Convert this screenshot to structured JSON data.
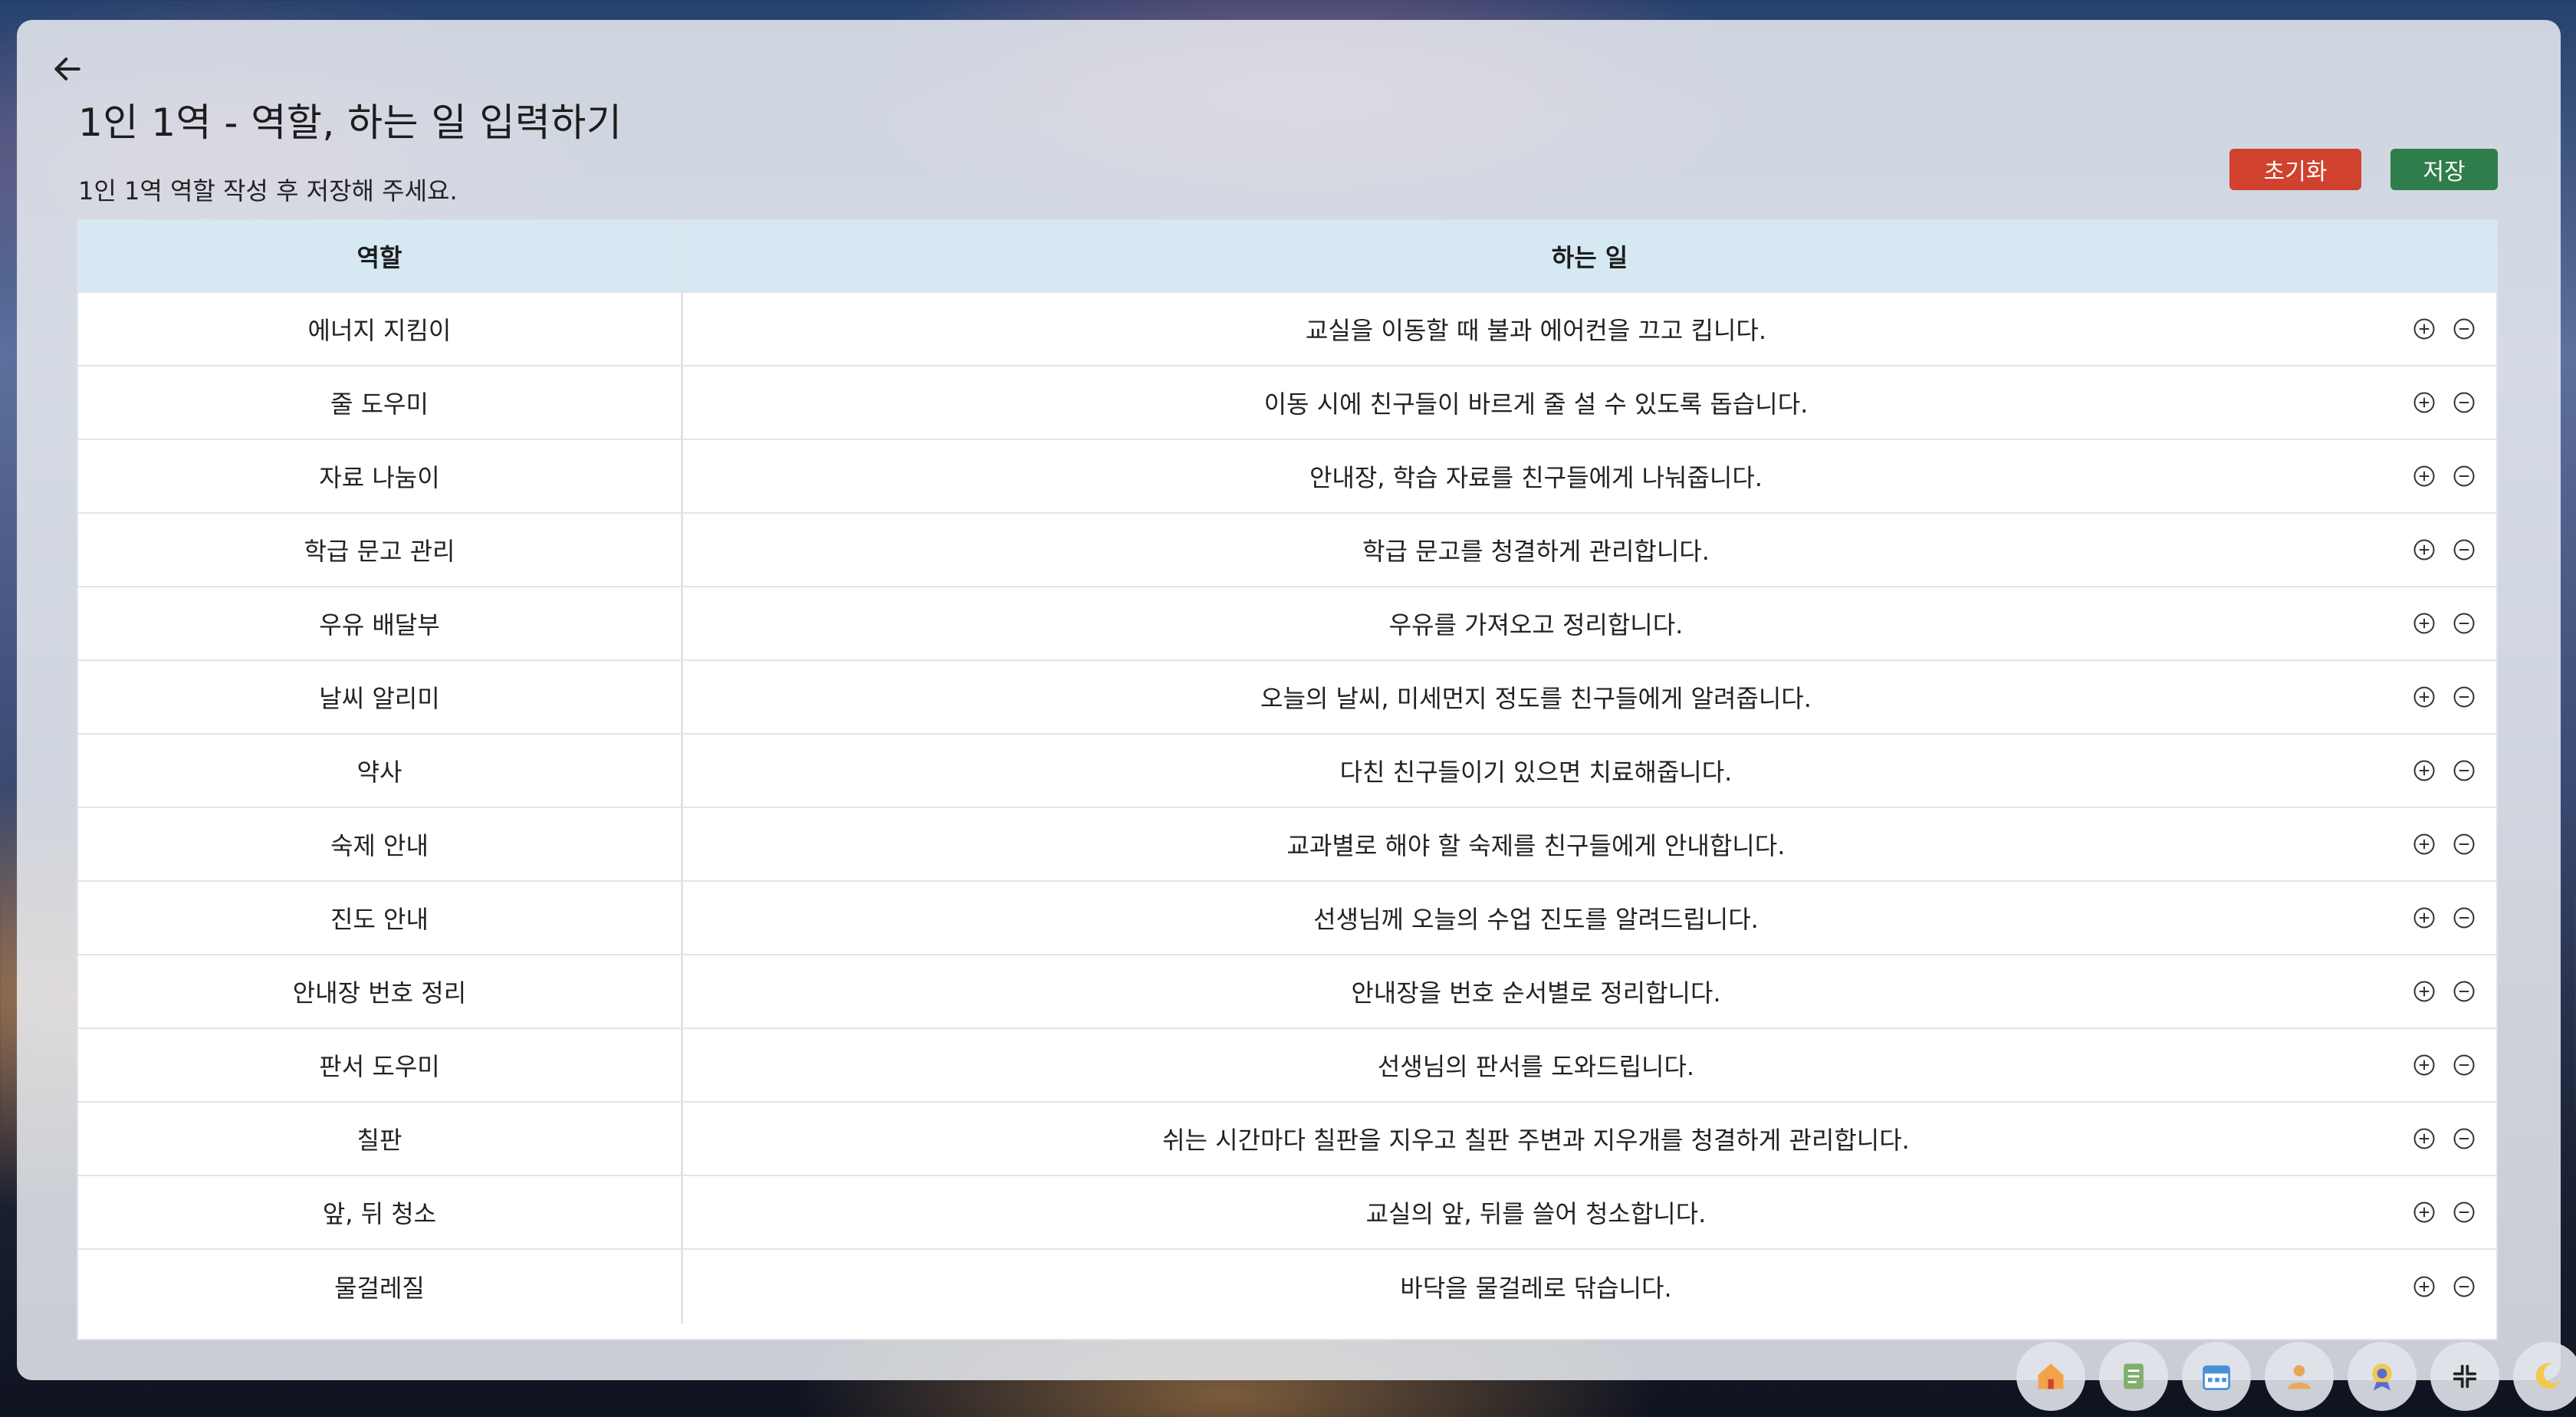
{
  "page": {
    "title": "1인 1역 - 역할, 하는 일 입력하기",
    "instruction": "1인 1역 역할 작성 후 저장해 주세요."
  },
  "buttons": {
    "reset": "초기화",
    "save": "저장"
  },
  "colors": {
    "reset": "#d0412e",
    "save": "#2e7d4a",
    "header_bg": "#d6e9f2"
  },
  "table": {
    "headers": [
      "역할",
      "하는 일"
    ],
    "rows": [
      {
        "role": "에너지 지킴이",
        "task": "교실을 이동할 때 불과 에어컨을 끄고 킵니다."
      },
      {
        "role": "줄 도우미",
        "task": "이동 시에 친구들이 바르게 줄 설 수 있도록 돕습니다."
      },
      {
        "role": "자료 나눔이",
        "task": "안내장, 학습 자료를 친구들에게 나눠줍니다."
      },
      {
        "role": "학급 문고 관리",
        "task": "학급 문고를 청결하게 관리합니다."
      },
      {
        "role": "우유 배달부",
        "task": "우유를 가져오고 정리합니다."
      },
      {
        "role": "날씨 알리미",
        "task": "오늘의 날씨, 미세먼지 정도를 친구들에게 알려줍니다."
      },
      {
        "role": "약사",
        "task": "다친 친구들이기 있으면 치료해줍니다."
      },
      {
        "role": "숙제 안내",
        "task": "교과별로 해야 할 숙제를 친구들에게 안내합니다."
      },
      {
        "role": "진도 안내",
        "task": "선생님께 오늘의 수업 진도를 알려드립니다."
      },
      {
        "role": "안내장 번호 정리",
        "task": "안내장을 번호 순서별로 정리합니다."
      },
      {
        "role": "판서 도우미",
        "task": "선생님의 판서를 도와드립니다."
      },
      {
        "role": "칠판",
        "task": "쉬는 시간마다 칠판을 지우고 칠판 주변과 지우개를 청결하게 관리합니다."
      },
      {
        "role": "앞, 뒤 청소",
        "task": "교실의 앞, 뒤를 쓸어 청소합니다."
      },
      {
        "role": "물걸레질",
        "task": "바닥을 물걸레로 닦습니다."
      }
    ]
  },
  "icons": {
    "back": "arrow-left-icon",
    "add_row": "plus-circle-icon",
    "remove_row": "minus-circle-icon"
  },
  "dock": [
    "home-icon",
    "notes-icon",
    "calendar-icon",
    "person-icon",
    "badge-icon",
    "collapse-icon",
    "moon-icon"
  ]
}
